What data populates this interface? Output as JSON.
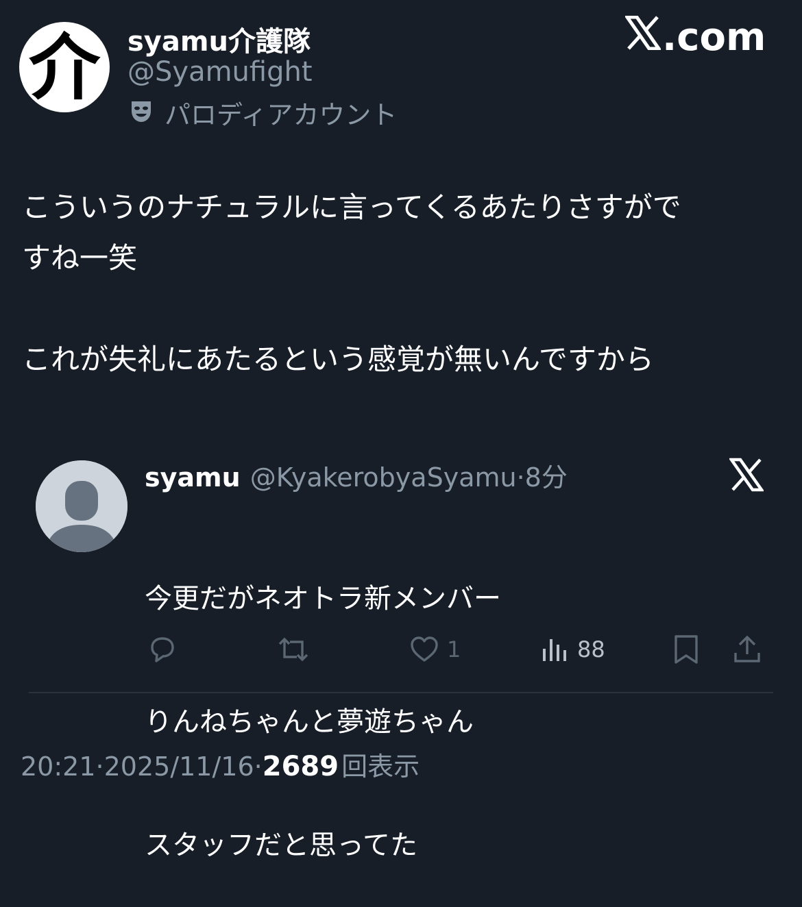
{
  "header": {
    "avatar_glyph": "介",
    "display_name": "syamu介護隊",
    "handle": "@Syamufight",
    "parody_label": "パロディアカウント",
    "brand": ".com"
  },
  "tweet": {
    "text": "こういうのナチュラルに言ってくるあたりさすがで\nすね一笑\n\nこれが失礼にあたるという感覚が無いんですから"
  },
  "quote": {
    "name": "syamu",
    "handle": "@KyakerobyaSyamu",
    "separator": "·",
    "time": "8分",
    "lines": [
      "今更だがネオトラ新メンバー",
      "りんねちゃんと夢遊ちゃん",
      "スタッフだと思ってた"
    ]
  },
  "actions": {
    "like_count": "1",
    "views_count": "88"
  },
  "footer": {
    "time": "20:21",
    "sep1": " · ",
    "date": "2025/11/16",
    "sep2": " · ",
    "views": "2689",
    "views_label": "回表示"
  },
  "colors": {
    "background": "#171e28",
    "text_primary": "#ffffff",
    "text_secondary": "#8b98a5",
    "icon_dim": "#5b6773"
  },
  "icons": [
    "drama-mask-icon",
    "x-logo-icon",
    "reply-icon",
    "retweet-icon",
    "like-icon",
    "views-icon",
    "bookmark-icon",
    "share-icon",
    "default-avatar-icon"
  ]
}
